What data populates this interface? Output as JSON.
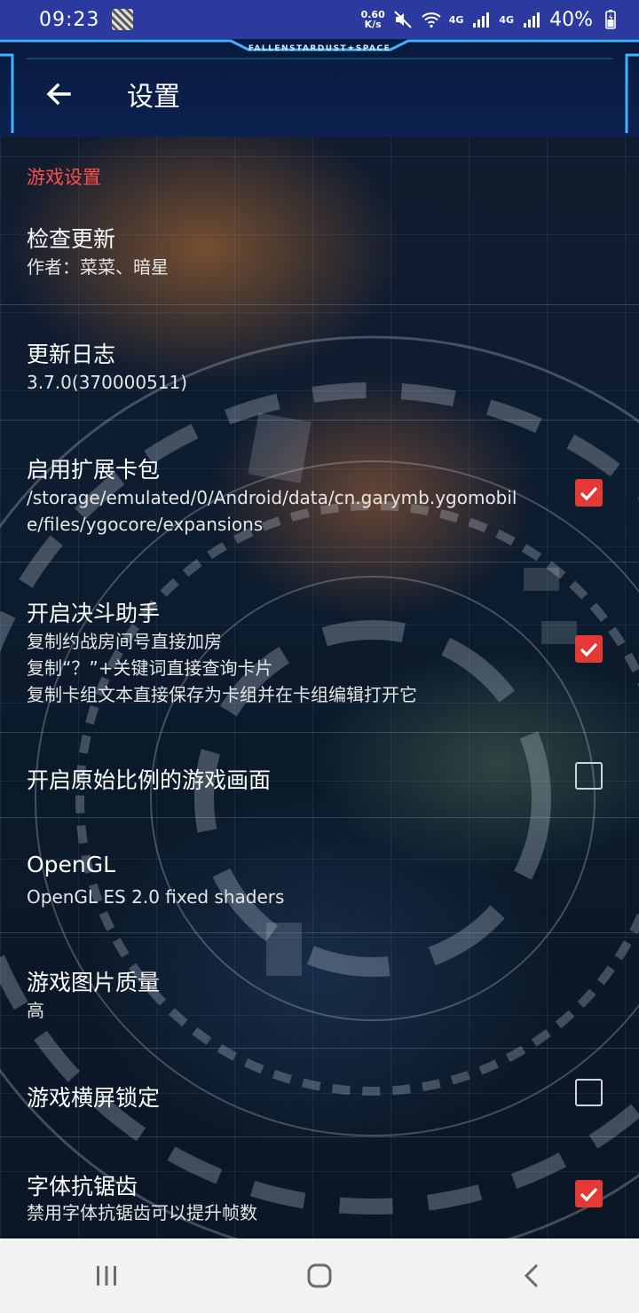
{
  "status_bar": {
    "time": "09:23",
    "net_speed_value": "0.60",
    "net_speed_unit": "K/s",
    "net1": "4G",
    "net2": "4G",
    "battery": "40%"
  },
  "header": {
    "brand": "FALLENSTARDUST★SPACE",
    "title": "设置"
  },
  "settings": {
    "section_title": "游戏设置",
    "items": [
      {
        "title": "检查更新",
        "summary": "作者：菜菜、暗星"
      },
      {
        "title": "更新日志",
        "summary": "3.7.0(370000511)"
      },
      {
        "title": "启用扩展卡包",
        "summary": "/storage/emulated/0/Android/data/cn.garymb.ygomobile/files/ygocore/expansions",
        "checked": true
      },
      {
        "title": "开启决斗助手",
        "summary_lines": [
          "复制约战房间号直接加房",
          "复制“？”+关键词直接查询卡片",
          "复制卡组文本直接保存为卡组并在卡组编辑打开它"
        ],
        "checked": true
      },
      {
        "title": "开启原始比例的游戏画面",
        "checked": false
      },
      {
        "title": "OpenGL",
        "summary": "OpenGL ES 2.0 fixed shaders"
      },
      {
        "title": "游戏图片质量",
        "summary": "高"
      },
      {
        "title": "游戏横屏锁定",
        "checked": false
      },
      {
        "title": "字体抗锯齿",
        "summary": "禁用字体抗锯齿可以提升帧数",
        "checked": true
      }
    ]
  },
  "colors": {
    "accent": "#e53935",
    "section_header": "#ff4d4d",
    "status_bar": "#2c3aa0",
    "nav_bar": "#f2f2f2"
  },
  "nav": {
    "recents_icon": "recents-icon",
    "home_icon": "home-icon",
    "back_icon": "back-icon"
  }
}
